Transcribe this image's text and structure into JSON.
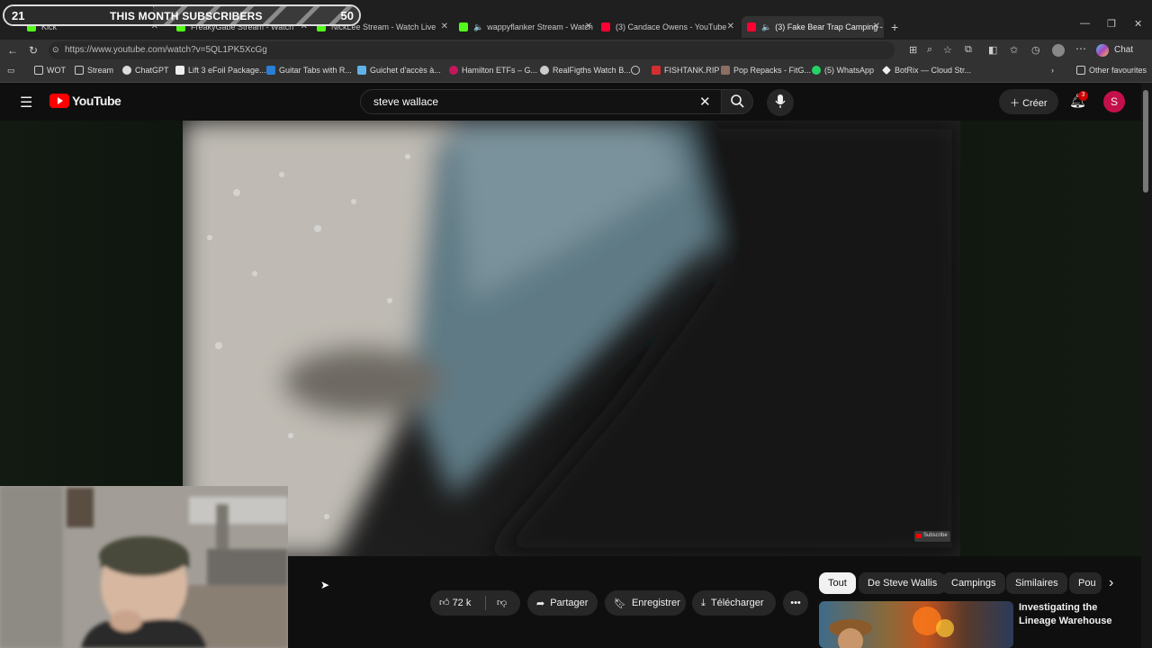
{
  "overlay": {
    "left_count": "21",
    "title": "THIS MONTH SUBSCRIBERS",
    "right_count": "50",
    "progress": 0.42
  },
  "tabs": [
    {
      "label": "Kick"
    },
    {
      "label": "FreakyGabe Stream - Watch"
    },
    {
      "label": "NickLee Stream - Watch Live"
    },
    {
      "label": "wappyflanker Stream - Watch"
    },
    {
      "label": "(3) Candace Owens - YouTube"
    },
    {
      "label": "(3) Fake Bear Trap Camping -"
    }
  ],
  "browser": {
    "url": "https://www.youtube.com/watch?v=5QL1PK5XcGg",
    "chat_label": "Chat"
  },
  "bookmarks": [
    {
      "label": "WOT"
    },
    {
      "label": "Stream"
    },
    {
      "label": "ChatGPT"
    },
    {
      "label": "Lift 3 eFoil Package..."
    },
    {
      "label": "Guitar Tabs with R..."
    },
    {
      "label": "Guichet d'accès à..."
    },
    {
      "label": "Hamilton ETFs – G..."
    },
    {
      "label": "RealFigths Watch B..."
    },
    {
      "label": "FISHTANK.RIP"
    },
    {
      "label": "Pop Repacks - FitG..."
    },
    {
      "label": "(5) WhatsApp"
    },
    {
      "label": "BotRix — Cloud Str..."
    }
  ],
  "other_favourites": "Other favourites",
  "youtube": {
    "logo": "YouTube",
    "search_value": "steve wallace",
    "create_label": "Créer",
    "notif_count": "3",
    "avatar_letter": "S",
    "watermark": "Subscribe"
  },
  "actions": {
    "likes": "72 k",
    "share": "Partager",
    "save": "Enregistrer",
    "download": "Télécharger"
  },
  "chips": [
    {
      "label": "Tout",
      "selected": true
    },
    {
      "label": "De Steve Wallis"
    },
    {
      "label": "Campings"
    },
    {
      "label": "Similaires"
    },
    {
      "label": "Pou"
    }
  ],
  "suggested": {
    "title": "Investigating the Lineage Warehouse Disaster (ft"
  },
  "colors": {
    "yt_red": "#ff0000",
    "bg": "#0f0f0f",
    "chip_selected": "#f1f1f1",
    "avatar": "#c4104a"
  }
}
